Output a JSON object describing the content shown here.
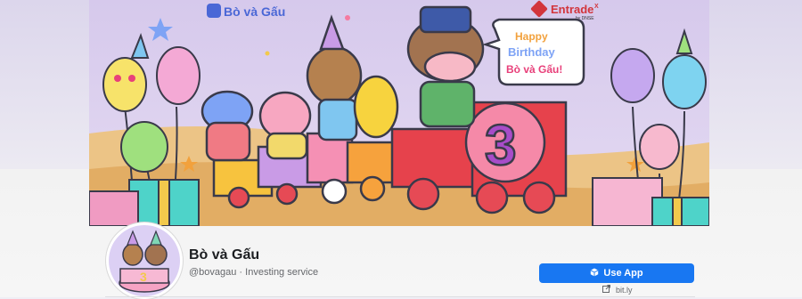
{
  "cover": {
    "brand_logo_text": "Bò và Gấu",
    "partner_logo_text": "Entrade",
    "partner_logo_super": "X",
    "partner_logo_sub": "by DNSE",
    "banner_line1": "Happy",
    "banner_line2": "Birthday",
    "banner_line3": "Bò và Gấu!",
    "cake_number": "3"
  },
  "page": {
    "name": "Bò và Gấu",
    "handle_category": "@bovagau · Investing service"
  },
  "actions": {
    "use_app_label": "Use App",
    "link_label": "bit.ly"
  },
  "colors": {
    "accent": "#1877f2",
    "cover_bg": "#d8cdec"
  },
  "icons": {
    "use_app": "app-cube-icon",
    "link": "external-link-icon"
  }
}
